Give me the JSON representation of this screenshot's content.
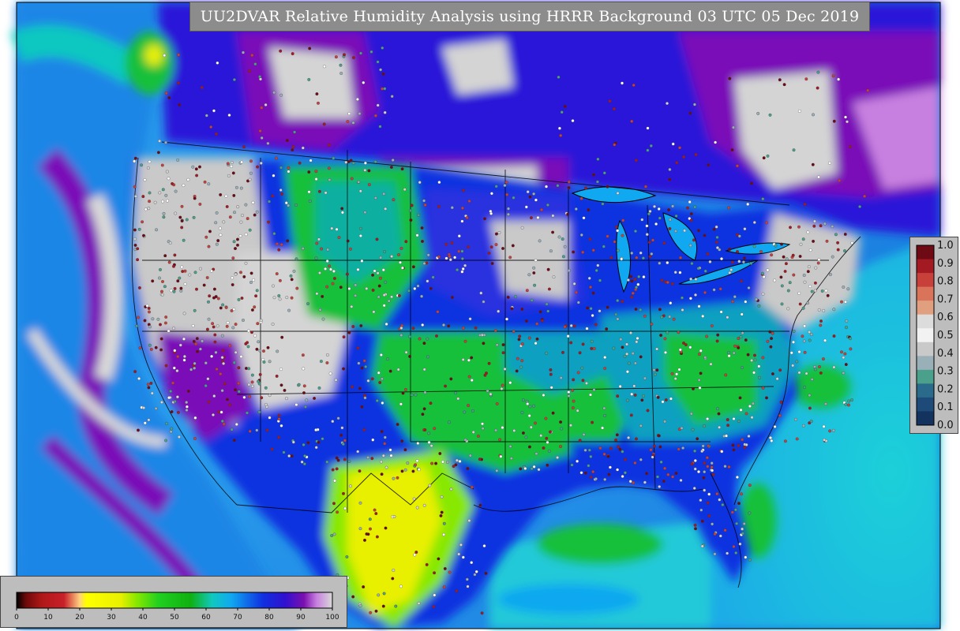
{
  "title": "UU2DVAR Relative Humidity Analysis using HRRR Background 03 UTC 05 Dec 2019",
  "confidence_legend": {
    "labels": [
      "1.0",
      "0.9",
      "0.8",
      "0.7",
      "0.6",
      "0.5",
      "0.4",
      "0.3",
      "0.2",
      "0.1",
      "0.0"
    ],
    "colors": [
      "#6e0a14",
      "#a31a22",
      "#c8403a",
      "#d9745a",
      "#e0a080",
      "#dcdcdc",
      "#f2f2f2",
      "#c9c9c9",
      "#9ab0b8",
      "#4aa08a",
      "#2a6a8a",
      "#1e4a7a",
      "#14325e"
    ]
  },
  "humidity_legend": {
    "labels": [
      "0",
      "10",
      "20",
      "30",
      "40",
      "50",
      "60",
      "70",
      "80",
      "90",
      "100"
    ],
    "stops": [
      {
        "value": 0,
        "color": "#000000"
      },
      {
        "value": 3,
        "color": "#6e0a0a"
      },
      {
        "value": 8,
        "color": "#b01818"
      },
      {
        "value": 15,
        "color": "#c8202a"
      },
      {
        "value": 20,
        "color": "#ffd080"
      },
      {
        "value": 22,
        "color": "#ffff00"
      },
      {
        "value": 33,
        "color": "#e8f000"
      },
      {
        "value": 38,
        "color": "#88e800"
      },
      {
        "value": 45,
        "color": "#20d020"
      },
      {
        "value": 55,
        "color": "#10b010"
      },
      {
        "value": 62,
        "color": "#10c8c0"
      },
      {
        "value": 68,
        "color": "#10a8f0"
      },
      {
        "value": 78,
        "color": "#1030e0"
      },
      {
        "value": 85,
        "color": "#3010d0"
      },
      {
        "value": 91,
        "color": "#7a10b0"
      },
      {
        "value": 95,
        "color": "#c880e0"
      },
      {
        "value": 100,
        "color": "#d8d8d8"
      }
    ]
  },
  "colors": {
    "ocean_west": "#1c8ee8",
    "ocean_east": "#19b6e6",
    "gulf": "#22c9d8",
    "canada": "#2a12d8",
    "high_rh": "#d4d4d4",
    "purple": "#7a10b8",
    "green": "#16c03a",
    "yellow": "#e8f000",
    "border": "#000000"
  }
}
